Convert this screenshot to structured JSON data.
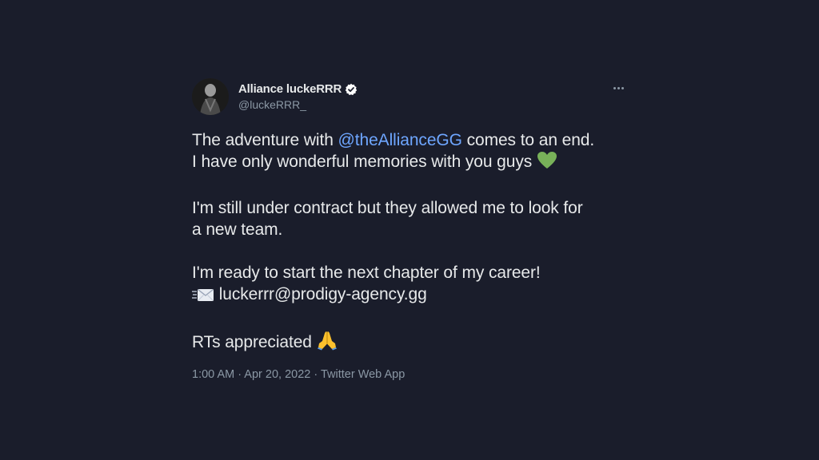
{
  "author": {
    "display_name": "Alliance luckeRRR",
    "handle": "@luckeRRR_",
    "verified": true
  },
  "tweet": {
    "line1_pre": "The adventure with ",
    "line1_mention": "@theAllianceGG",
    "line1_post": " comes to an end.",
    "line2": "I have only wonderful memories with you guys",
    "line3": "I'm still under contract but they allowed me to look for",
    "line4": "a new team.",
    "line5": "I'm ready to start the next chapter of my career!",
    "line6": " luckerrr@prodigy-agency.gg",
    "line7": "RTs appreciated "
  },
  "meta": {
    "time": "1:00 AM",
    "separator": " · ",
    "date": "Apr 20, 2022",
    "source": "Twitter Web App"
  },
  "icons": {
    "more": "more-horizontal-icon",
    "verified": "verified-badge-icon",
    "heart": "green-heart-emoji",
    "mail": "envelope-with-arrow-emoji",
    "pray": "folded-hands-emoji"
  },
  "colors": {
    "background": "#1a1d2b",
    "text": "#e7e9ea",
    "secondary": "#8b98a5",
    "mention": "#6ea6ff",
    "heart": "#78b159"
  }
}
